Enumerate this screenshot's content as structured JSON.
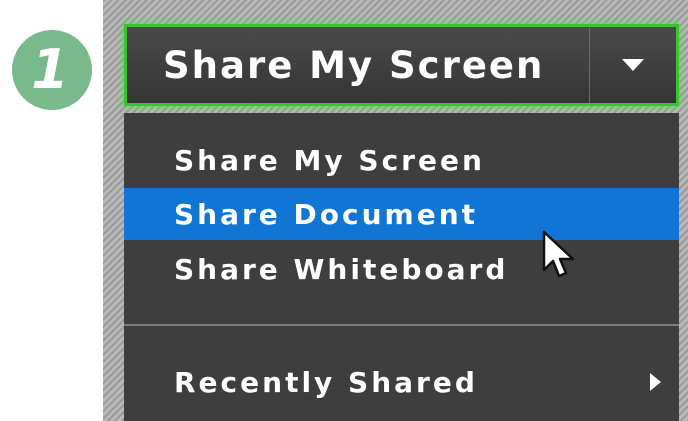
{
  "step": {
    "number": "1"
  },
  "share_button": {
    "label": "Share My Screen",
    "dropdown_icon": "chevron-down-icon"
  },
  "menu": {
    "items": [
      {
        "label": "Share My Screen",
        "selected": false
      },
      {
        "label": "Share Document",
        "selected": true
      },
      {
        "label": "Share Whiteboard",
        "selected": false
      }
    ],
    "submenu": {
      "label": "Recently Shared",
      "icon": "chevron-right-icon"
    }
  },
  "colors": {
    "highlight": "#1175d6",
    "focus_border": "#39c32f",
    "menu_background": "#3e3e3e",
    "badge": "#7ab98c"
  },
  "cursor": {
    "icon": "mouse-pointer-icon"
  }
}
